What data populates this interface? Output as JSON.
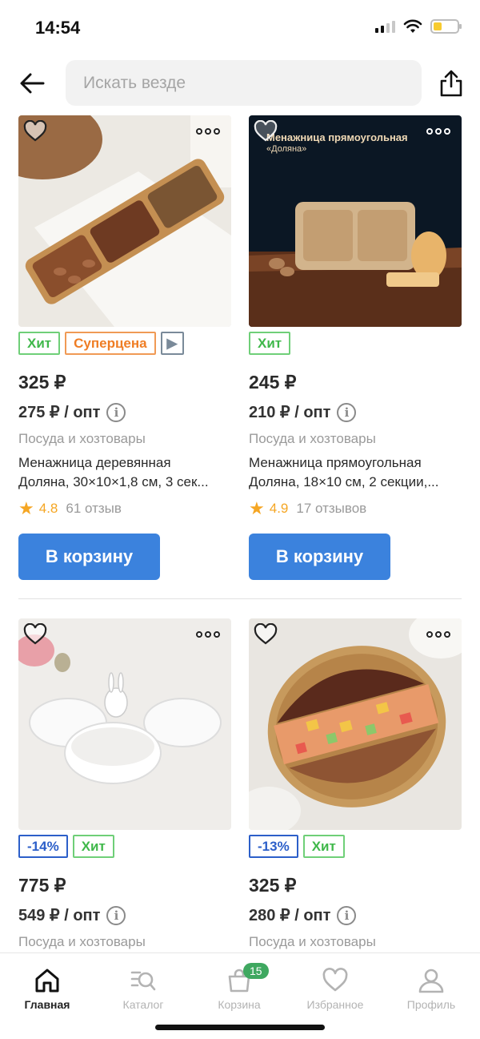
{
  "status_bar": {
    "time": "14:54"
  },
  "header": {
    "search_placeholder": "Искать везде"
  },
  "products": [
    {
      "badges": [
        {
          "type": "hit",
          "label": "Хит"
        },
        {
          "type": "super",
          "label": "Суперцена"
        },
        {
          "type": "video",
          "label": "▶"
        }
      ],
      "price": "325 ₽",
      "opt_price": "275 ₽ / опт",
      "category": "Посуда и хозтовары",
      "name_line1": "Менажница деревянная",
      "name_line2": "Доляна, 30×10×1,8 см, 3 сек...",
      "rating": "4.8",
      "reviews": "61 отзыв",
      "button": "В корзину"
    },
    {
      "image_text_1": "Менажница прямоугольная",
      "image_text_2": "«Доляна»",
      "badges": [
        {
          "type": "hit",
          "label": "Хит"
        }
      ],
      "price": "245 ₽",
      "opt_price": "210 ₽ / опт",
      "category": "Посуда и хозтовары",
      "name_line1": "Менажница прямоугольная",
      "name_line2": "Доляна, 18×10 см, 2 секции,...",
      "rating": "4.9",
      "reviews": "17 отзывов",
      "button": "В корзину"
    },
    {
      "badges": [
        {
          "type": "discount",
          "label": "-14%"
        },
        {
          "type": "hit",
          "label": "Хит"
        }
      ],
      "price": "775 ₽",
      "opt_price": "549 ₽ / опт",
      "category": "Посуда и хозтовары"
    },
    {
      "badges": [
        {
          "type": "discount",
          "label": "-13%"
        },
        {
          "type": "hit",
          "label": "Хит"
        }
      ],
      "price": "325 ₽",
      "opt_price": "280 ₽ / опт",
      "category": "Посуда и хозтовары"
    }
  ],
  "tabbar": {
    "home": "Главная",
    "catalog": "Каталог",
    "cart": "Корзина",
    "cart_count": "15",
    "favorites": "Избранное",
    "profile": "Профиль"
  },
  "colors": {
    "accent": "#3b82dd",
    "hit": "#3fb84a",
    "super": "#ef7d24",
    "discount": "#2c5fc9",
    "star": "#f5a623"
  }
}
